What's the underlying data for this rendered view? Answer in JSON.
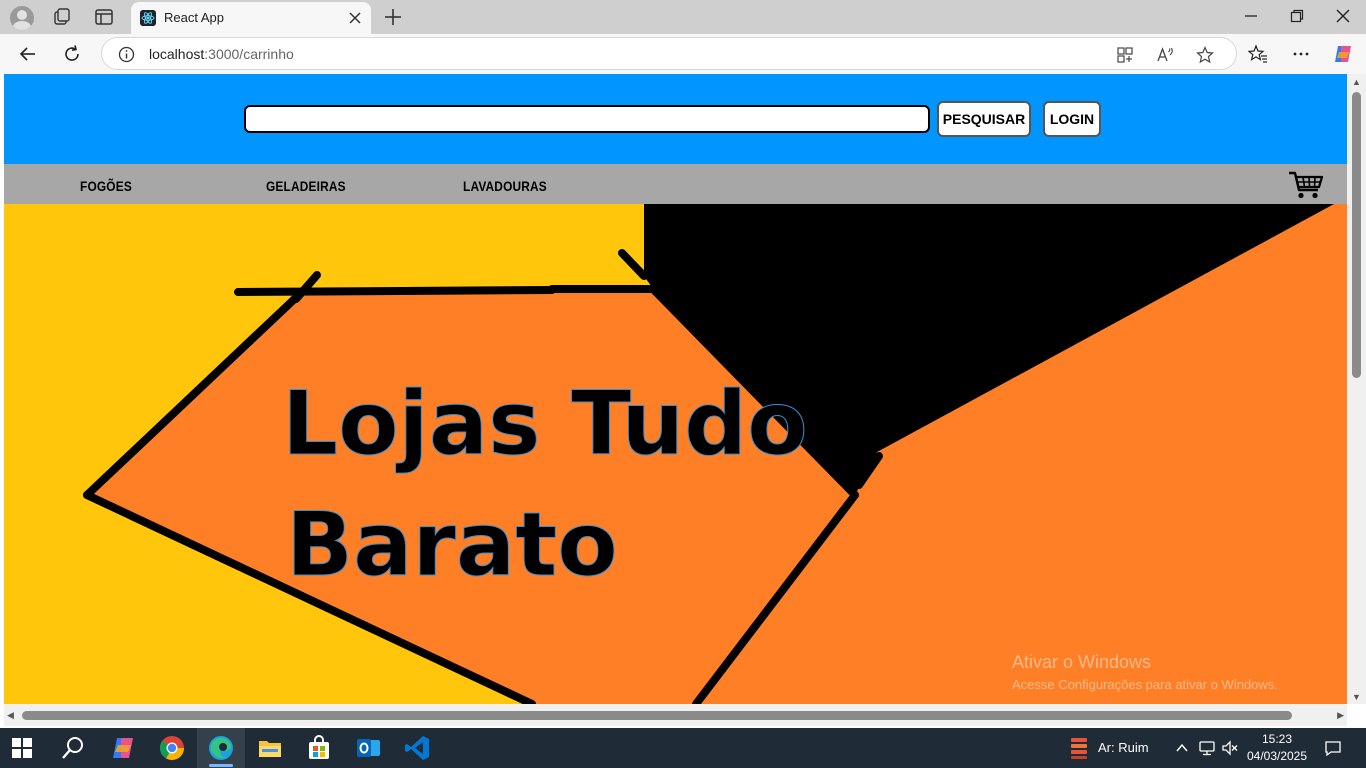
{
  "browser": {
    "tab": {
      "title": "React App",
      "favicon": "react-logo-icon"
    },
    "address": {
      "host": "localhost",
      "path": ":3000/carrinho"
    },
    "window_controls": [
      "minimize-icon",
      "restore-icon",
      "close-icon"
    ]
  },
  "page": {
    "header": {
      "search": {
        "value": "",
        "placeholder": ""
      },
      "search_button": "PESQUISAR",
      "login_button": "LOGIN",
      "background": "#0095ff"
    },
    "nav": {
      "items": [
        {
          "label": "FOGÕES"
        },
        {
          "label": "GELADEIRAS"
        },
        {
          "label": "LAVADOURAS"
        }
      ],
      "cart_icon": "shopping-cart-icon",
      "background": "#a7a7a7"
    },
    "banner": {
      "line1": "Lojas Tudo",
      "line2": "Barato",
      "colors": {
        "yellow": "#ffc60b",
        "orange": "#ff7f27",
        "black": "#000000"
      }
    },
    "watermark": {
      "title": "Ativar o Windows",
      "subtitle": "Acesse Configurações para ativar o Windows."
    }
  },
  "taskbar": {
    "air_quality": "Ar: Ruim",
    "time": "15:23",
    "date": "04/03/2025",
    "apps": [
      "start-icon",
      "search-icon",
      "copilot-icon",
      "chrome-icon",
      "edge-icon",
      "file-explorer-icon",
      "microsoft-store-icon",
      "outlook-icon",
      "vscode-icon"
    ]
  }
}
